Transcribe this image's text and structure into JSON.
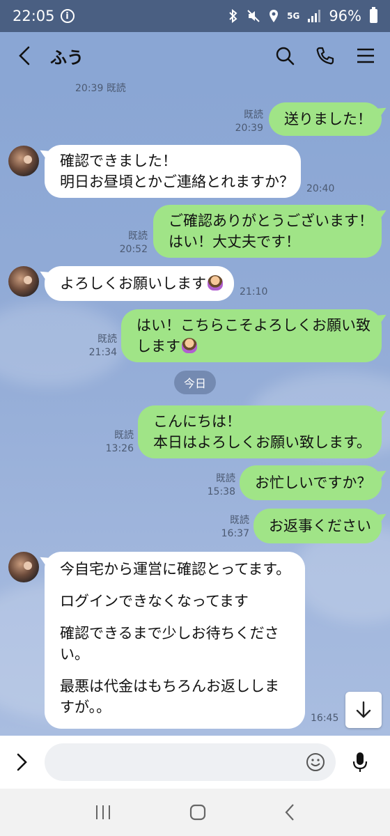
{
  "status_bar": {
    "time": "22:05",
    "network": "5G",
    "battery": "96%"
  },
  "header": {
    "contact_name": "ふう"
  },
  "date_separator": "今日",
  "messages": [
    {
      "dir": "out",
      "lines": [
        "送りました！"
      ],
      "read": "既読",
      "time": "20:39"
    },
    {
      "dir": "in",
      "lines": [
        "確認できました！",
        "明日お昼頃とかご連絡とれますか？"
      ],
      "time": "20:40"
    },
    {
      "dir": "out",
      "lines": [
        "ご確認ありがとうございます！",
        "はい！大丈夫です！"
      ],
      "read": "既読",
      "time": "20:52"
    },
    {
      "dir": "in",
      "lines": [
        "よろしくお願いします"
      ],
      "time": "21:10"
    },
    {
      "dir": "out",
      "lines": [
        "はい！こちらこそよろしくお願い致",
        "します"
      ],
      "read": "既読",
      "time": "21:34"
    },
    {
      "dir": "out",
      "lines": [
        "こんにちは！",
        "本日はよろしくお願い致します。"
      ],
      "read": "既読",
      "time": "13:26"
    },
    {
      "dir": "out",
      "lines": [
        "お忙しいですか？"
      ],
      "read": "既読",
      "time": "15:38"
    },
    {
      "dir": "out",
      "lines": [
        "お返事ください"
      ],
      "read": "既読",
      "time": "16:37"
    },
    {
      "dir": "in",
      "paragraphs": [
        "今自宅から運営に確認とってます。",
        "ログインできなくなってます",
        "確認できるまで少しお待ちくださ",
        "い。",
        "最悪は代金はもちろんお返ししますが。。"
      ],
      "time": "16:45"
    }
  ],
  "top_partial": {
    "time": "20:39",
    "read": "既読"
  },
  "colors": {
    "status_bar": "#4a5f82",
    "chat_bg": "#8aa6d4",
    "out_bubble": "#a0e487",
    "in_bubble": "#ffffff"
  }
}
